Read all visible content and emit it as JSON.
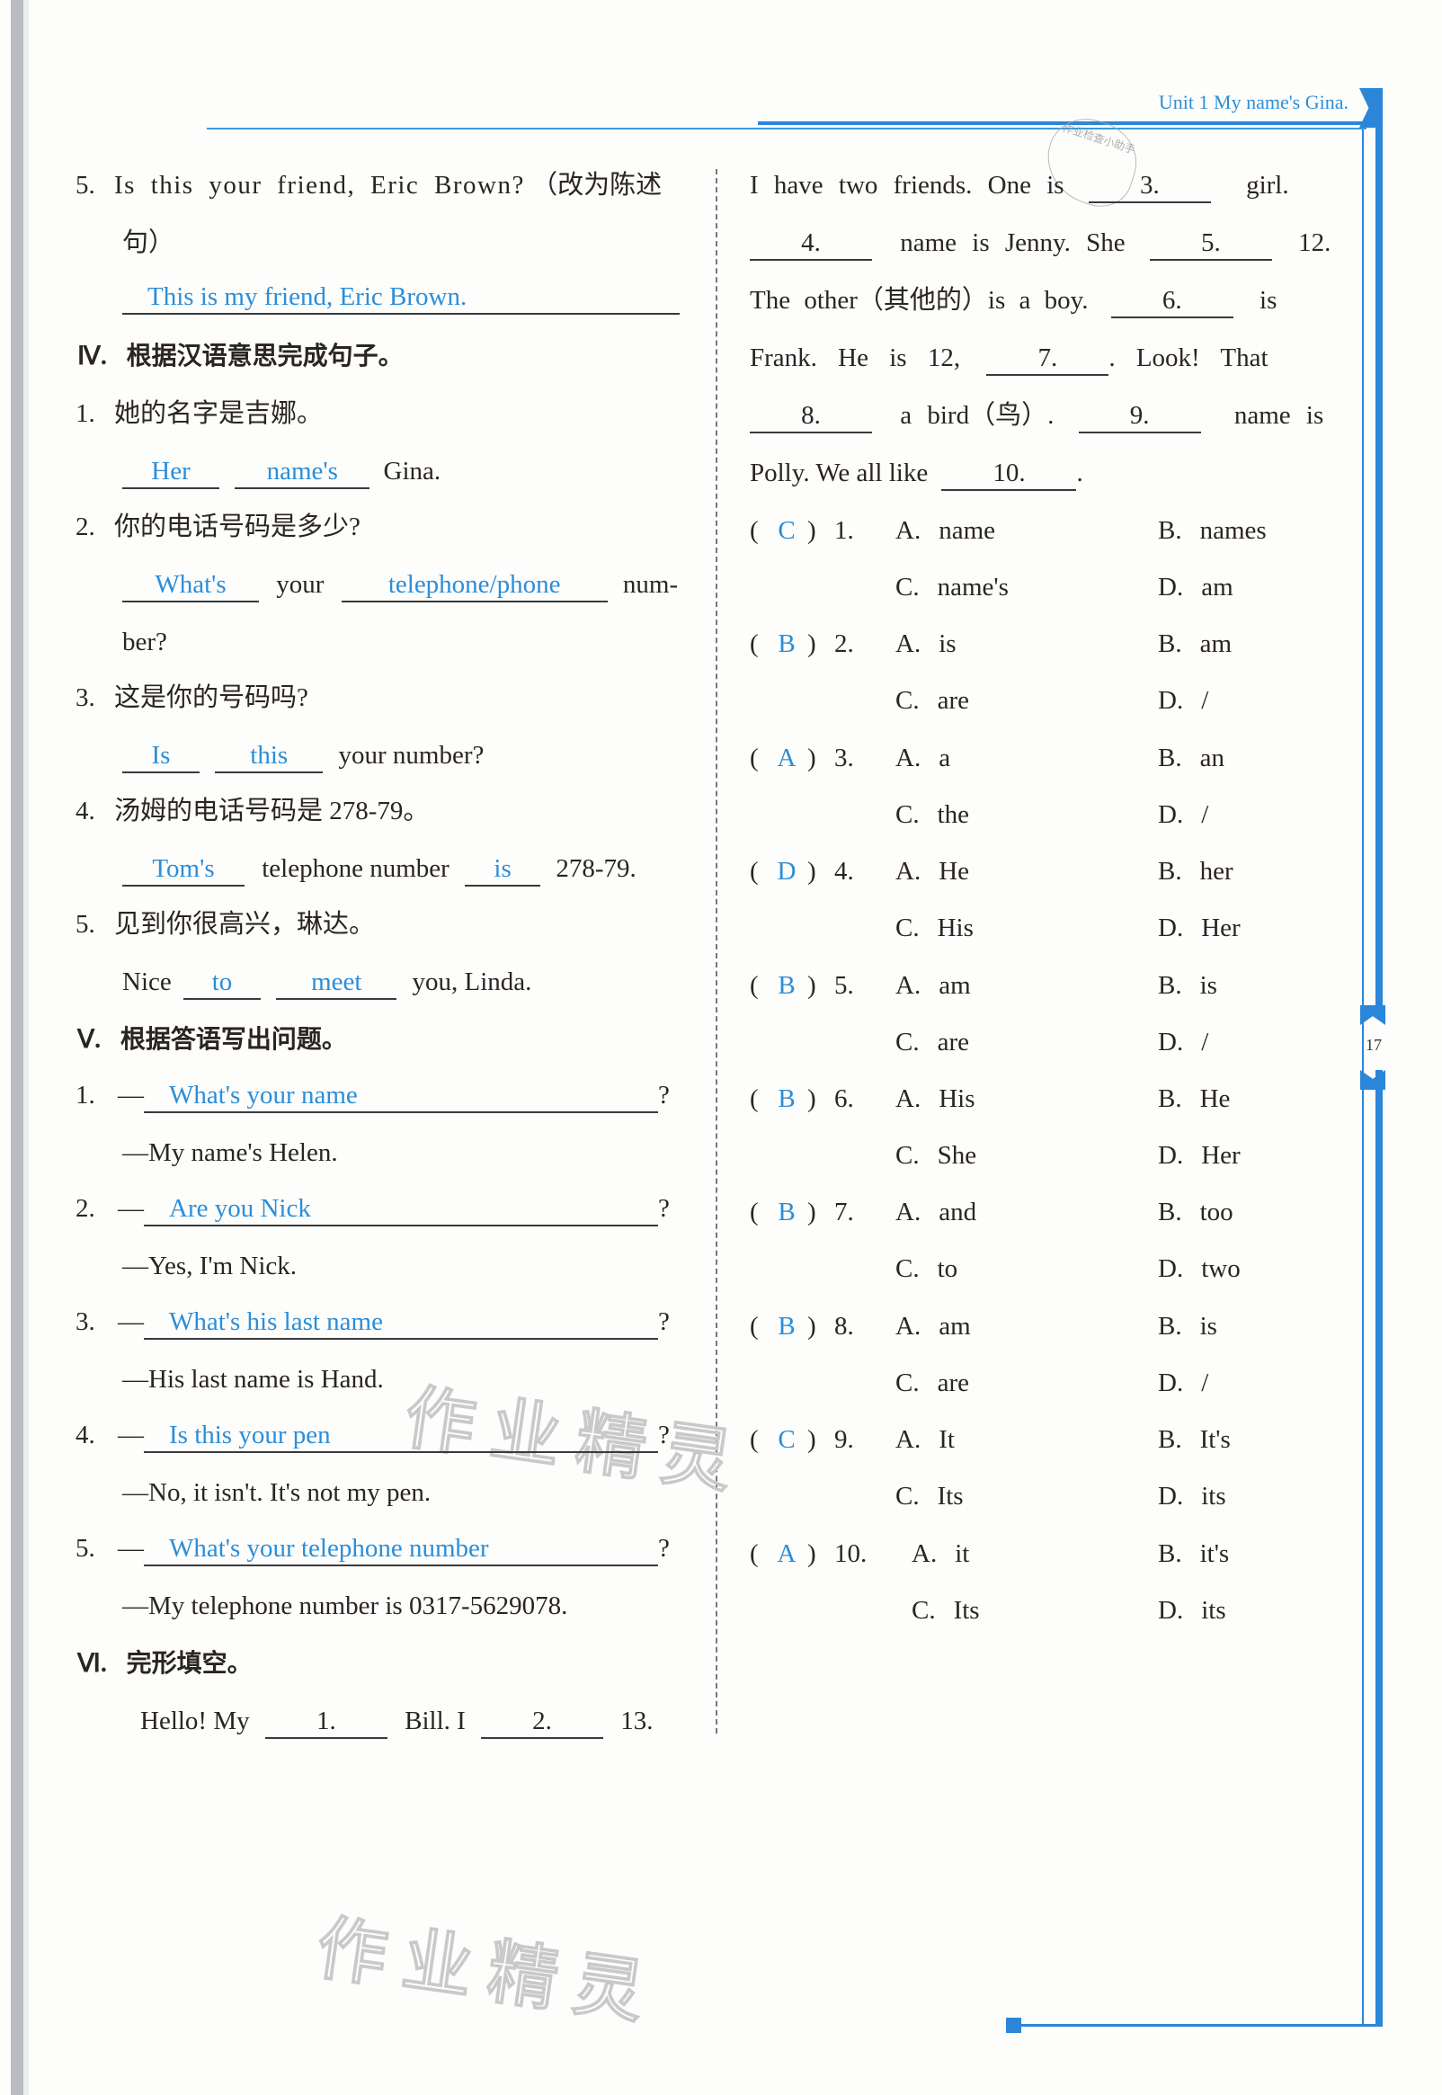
{
  "header": {
    "unit_title": "Unit 1 My name's Gina.",
    "page_number": "17"
  },
  "left": {
    "q3_5": {
      "num": "5.",
      "prompt": "Is this your friend, Eric Brown?",
      "instruction": "（改为陈述",
      "instruction_cont": "句）",
      "answer": "This is my friend, Eric Brown."
    },
    "section4": {
      "roman": "Ⅳ.",
      "title": "根据汉语意思完成句子。",
      "items": [
        {
          "num": "1.",
          "prompt": "她的名字是吉娜。",
          "blanks": [
            "Her",
            "name's"
          ],
          "tail": "Gina."
        },
        {
          "num": "2.",
          "prompt": "你的电话号码是多少?",
          "blanks": [
            "What's",
            "telephone/phone"
          ],
          "mid": "your",
          "tail": "num-",
          "tail2": "ber?"
        },
        {
          "num": "3.",
          "prompt": "这是你的号码吗?",
          "blanks": [
            "Is",
            "this"
          ],
          "tail": "your number?"
        },
        {
          "num": "4.",
          "prompt": "汤姆的电话号码是 278-79。",
          "blanks": [
            "Tom's",
            "is"
          ],
          "mid": "telephone number",
          "tail": "278-79."
        },
        {
          "num": "5.",
          "prompt": "见到你很高兴，琳达。",
          "head": "Nice",
          "blanks": [
            "to",
            "meet"
          ],
          "tail": "you, Linda."
        }
      ]
    },
    "section5": {
      "roman": "Ⅴ.",
      "title": "根据答语写出问题。",
      "dash": "—",
      "qmark": "?",
      "items": [
        {
          "num": "1.",
          "question": "What's your name",
          "reply": "—My name's Helen."
        },
        {
          "num": "2.",
          "question": "Are you Nick",
          "reply": "—Yes, I'm Nick."
        },
        {
          "num": "3.",
          "question": "What's his last name",
          "reply": "—His last name is Hand."
        },
        {
          "num": "4.",
          "question": "Is this your pen",
          "reply": "—No, it isn't. It's not my pen."
        },
        {
          "num": "5.",
          "question": "What's your telephone number",
          "reply": "—My telephone number is 0317-5629078."
        }
      ]
    },
    "section6": {
      "roman": "Ⅵ.",
      "title": "完形填空。",
      "line1": {
        "a": "Hello! My",
        "b1": "1.",
        "b": "Bill. I",
        "b2": "2.",
        "c": "13."
      }
    }
  },
  "right": {
    "passage": {
      "l1": {
        "a": "I have two friends. One is",
        "blank": "3.",
        "b": "girl."
      },
      "l2": {
        "blank1": "4.",
        "a": "name is Jenny. She",
        "blank2": "5.",
        "b": "12."
      },
      "l3": {
        "a": "The other（其他的）is a boy.",
        "blank": "6.",
        "b": "is"
      },
      "l4": {
        "a": "Frank. He is 12,",
        "blank": "7.",
        "b": ". Look! That"
      },
      "l5": {
        "blank1": "8.",
        "a": "a bird（鸟）.",
        "blank2": "9.",
        "b": "name is"
      },
      "l6": {
        "a": "Polly. We all like",
        "blank": "10.",
        "b": "."
      }
    },
    "choices": [
      {
        "num": "1.",
        "answer": "C",
        "A": "name",
        "B": "names",
        "C": "name's",
        "D": "am"
      },
      {
        "num": "2.",
        "answer": "B",
        "A": "is",
        "B": "am",
        "C": "are",
        "D": "/"
      },
      {
        "num": "3.",
        "answer": "A",
        "A": "a",
        "B": "an",
        "C": "the",
        "D": "/"
      },
      {
        "num": "4.",
        "answer": "D",
        "A": "He",
        "B": "her",
        "C": "His",
        "D": "Her"
      },
      {
        "num": "5.",
        "answer": "B",
        "A": "am",
        "B": "is",
        "C": "are",
        "D": "/"
      },
      {
        "num": "6.",
        "answer": "B",
        "A": "His",
        "B": "He",
        "C": "She",
        "D": "Her"
      },
      {
        "num": "7.",
        "answer": "B",
        "A": "and",
        "B": "too",
        "C": "to",
        "D": "two"
      },
      {
        "num": "8.",
        "answer": "B",
        "A": "am",
        "B": "is",
        "C": "are",
        "D": "/"
      },
      {
        "num": "9.",
        "answer": "C",
        "A": "It",
        "B": "It's",
        "C": "Its",
        "D": "its"
      },
      {
        "num": "10.",
        "answer": "A",
        "A": "it",
        "B": "it's",
        "C": "Its",
        "D": "its"
      }
    ],
    "option_labels": {
      "A": "A.",
      "B": "B.",
      "C": "C.",
      "D": "D."
    },
    "paren_open": "(",
    "paren_close": ")"
  },
  "decor": {
    "stamp_text": "作业检查小助手",
    "watermark": "作业精灵"
  },
  "colors": {
    "accent_blue": "#2b86d8",
    "answer_blue": "#2b8ed8",
    "text": "#2a2523"
  }
}
